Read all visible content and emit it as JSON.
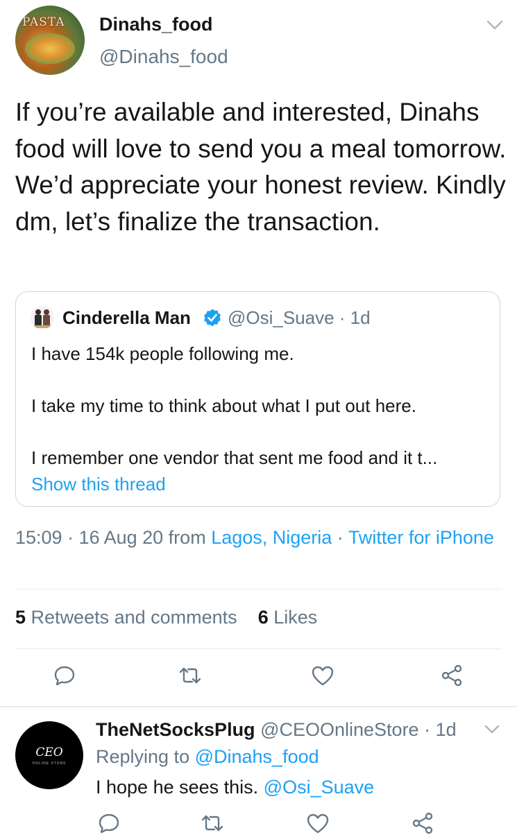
{
  "tweet": {
    "avatar_text": "PASTA",
    "author_name": "Dinahs_food",
    "author_handle": "@Dinahs_food",
    "text": "If you’re available and interested, Dinahs food will love to send you a meal tomorrow. We’d appreciate your honest review. Kindly dm, let’s finalize the transaction.",
    "quote": {
      "author_name": "Cinderella Man",
      "author_handle": "@Osi_Suave · 1d",
      "lines": [
        "I have 154k people following me.",
        "I take my time to think about what I put out here.",
        "I remember one vendor that sent me food and it t..."
      ],
      "show_thread": "Show this thread"
    },
    "meta": {
      "time_date": "15:09 · 16 Aug 20 from ",
      "location": "Lagos, Nigeria",
      "sep": " · ",
      "client": "Twitter for iPhone"
    },
    "stats": {
      "retweets_count": "5",
      "retweets_label": "Retweets and comments",
      "likes_count": "6",
      "likes_label": "Likes"
    },
    "actions": [
      "reply-icon",
      "retweet-icon",
      "like-icon",
      "share-icon"
    ]
  },
  "reply": {
    "avatar_text": "CEO",
    "avatar_subtext": "ONLINE STORE",
    "author_name": "TheNetSocksPlug",
    "author_handle": "@CEOOnlineStore · 1d",
    "replying_prefix": "Replying to ",
    "replying_handle": "@Dinahs_food",
    "text": "I hope he sees this. ",
    "mention": "@Osi_Suave"
  },
  "colors": {
    "accent": "#1da1f2",
    "secondary_text": "#657786",
    "primary_text": "#14171a",
    "border": "#ccd6dd"
  }
}
